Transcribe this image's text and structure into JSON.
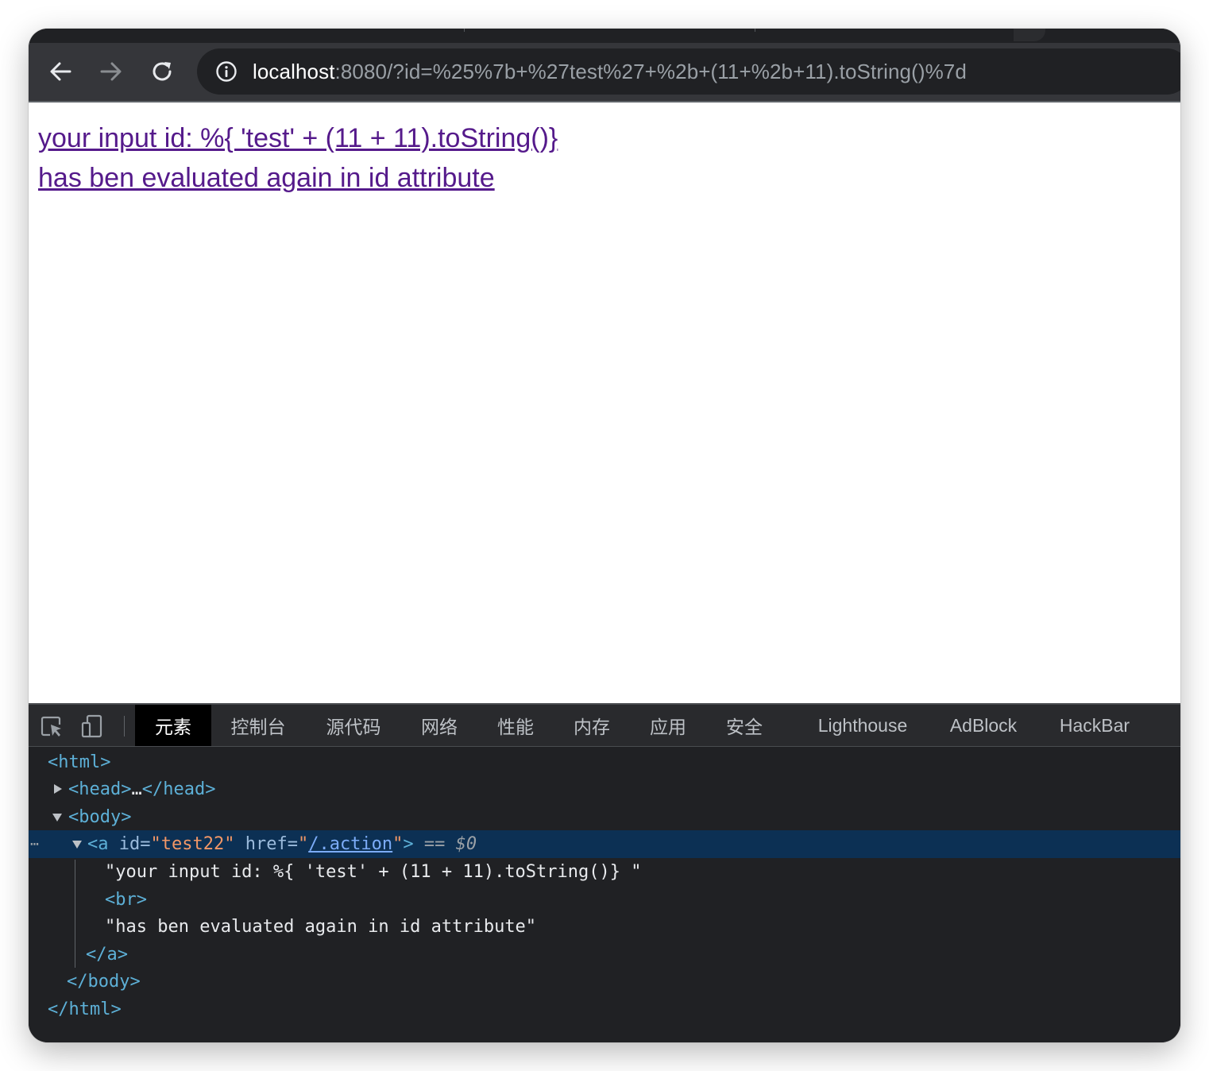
{
  "browser": {
    "url_host": "localhost",
    "url_rest": ":8080/?id=%25%7b+%27test%27+%2b+(11+%2b+11).toString()%7d"
  },
  "page": {
    "link_line1": "your input id: %{ 'test' + (11 + 11).toString()}",
    "link_line2": "has ben evaluated again in id attribute"
  },
  "devtools": {
    "tabs": [
      "元素",
      "控制台",
      "源代码",
      "网络",
      "性能",
      "内存",
      "应用",
      "安全",
      "Lighthouse",
      "AdBlock",
      "HackBar"
    ],
    "active_tab": "元素",
    "tree": {
      "html_open": "<html>",
      "head_open": "<head>",
      "head_ellipsis": "…",
      "head_close": "</head>",
      "body_open": "<body>",
      "a_open_start": "<a",
      "a_id_name": "id=",
      "a_id_value": "\"test22\"",
      "a_href_name": "href=",
      "a_href_quote_open": "\"",
      "a_href_value": "/.action",
      "a_href_quote_close": "\"",
      "a_open_end": ">",
      "selected_marker": "== $0",
      "text1": "\"your input id: %{ 'test' + (11 + 11).toString()} \"",
      "br": "<br>",
      "text2": "\"has ben evaluated again in id attribute\"",
      "a_close": "</a>",
      "body_close": "</body>",
      "html_close": "</html>",
      "row_menu": "⋯"
    }
  }
}
